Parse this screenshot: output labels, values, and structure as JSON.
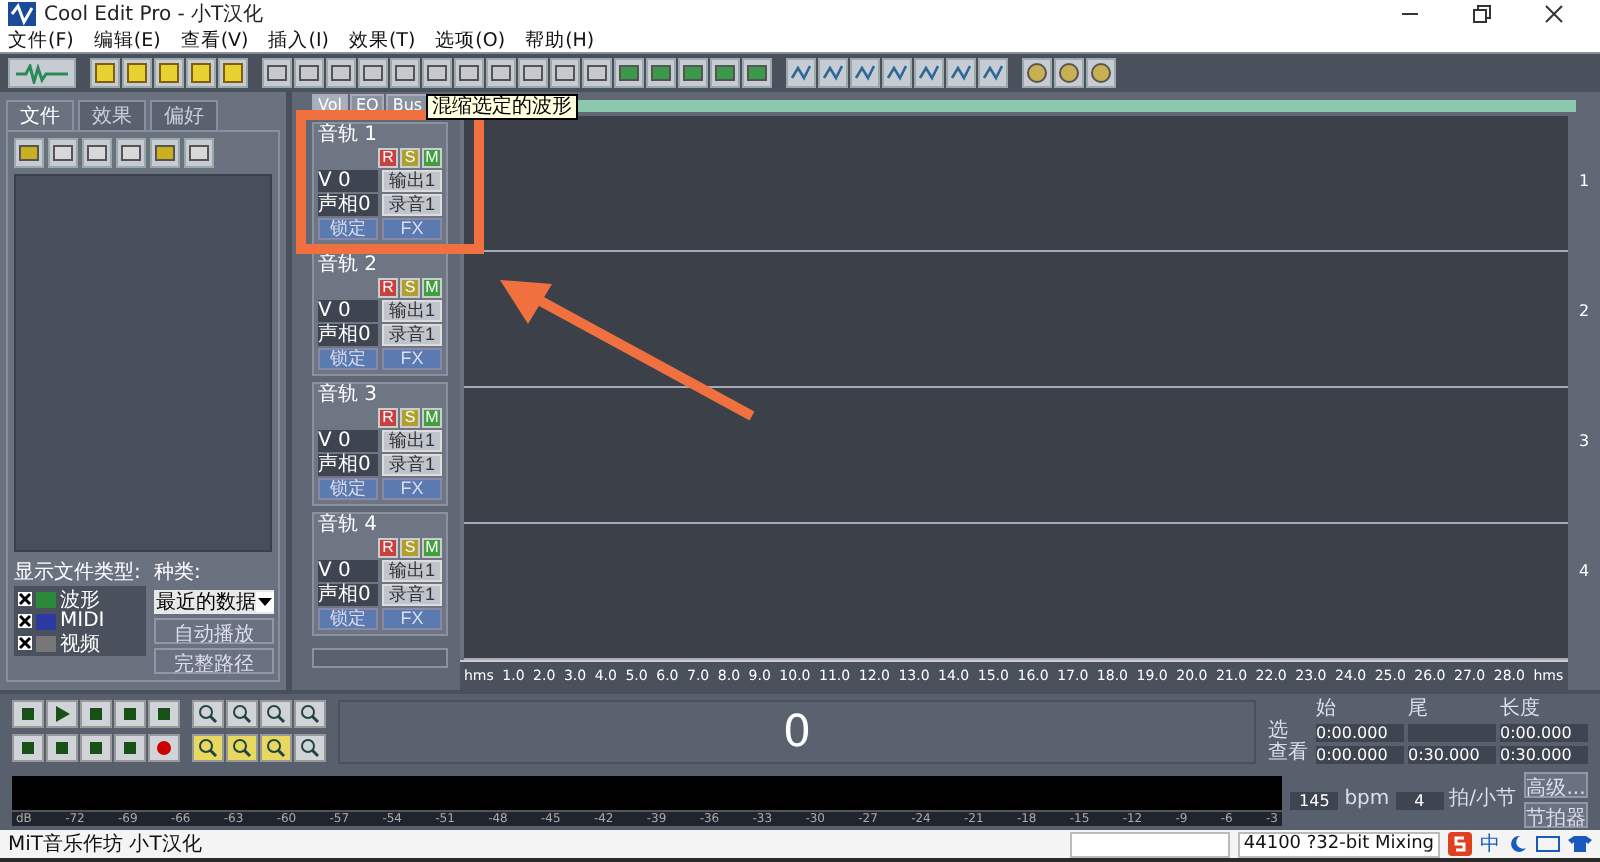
{
  "window": {
    "title": "Cool Edit Pro  - 小T汉化"
  },
  "menu": [
    "文件(F)",
    "编辑(E)",
    "查看(V)",
    "插入(I)",
    "效果(T)",
    "选项(O)",
    "帮助(H)"
  ],
  "left_panel": {
    "tabs": [
      {
        "label": "文件",
        "selected": true
      },
      {
        "label": "效果",
        "selected": false
      },
      {
        "label": "偏好",
        "selected": false
      }
    ],
    "file_types_label": "显示文件类型:",
    "file_types": [
      {
        "label": "波形",
        "checked": true
      },
      {
        "label": "MIDI",
        "checked": true
      },
      {
        "label": "视频",
        "checked": true
      }
    ],
    "sort_label": "种类:",
    "sort_value": "最近的数据",
    "buttons": [
      "自动播放",
      "完整路径"
    ]
  },
  "mixer_tabs": [
    {
      "label": "Vol",
      "selected": true
    },
    {
      "label": "EQ",
      "selected": false
    },
    {
      "label": "Bus",
      "selected": false
    }
  ],
  "tooltip": "混缩选定的波形",
  "tracks": [
    {
      "name": "音轨 1",
      "number": "1",
      "buttons": [
        {
          "kind": "record",
          "label": "R"
        },
        {
          "kind": "solo",
          "label": "S"
        },
        {
          "kind": "mute",
          "label": "M"
        }
      ],
      "volume": "V 0",
      "pan": "声相0",
      "output": "输出1",
      "input": "录音1",
      "lock": "锁定",
      "fx": "FX"
    },
    {
      "name": "音轨 2",
      "number": "2",
      "buttons": [
        {
          "kind": "record",
          "label": "R"
        },
        {
          "kind": "solo",
          "label": "S"
        },
        {
          "kind": "mute",
          "label": "M"
        }
      ],
      "volume": "V 0",
      "pan": "声相0",
      "output": "输出1",
      "input": "录音1",
      "lock": "锁定",
      "fx": "FX"
    },
    {
      "name": "音轨 3",
      "number": "3",
      "buttons": [
        {
          "kind": "record",
          "label": "R"
        },
        {
          "kind": "solo",
          "label": "S"
        },
        {
          "kind": "mute",
          "label": "M"
        }
      ],
      "volume": "V 0",
      "pan": "声相0",
      "output": "输出1",
      "input": "录音1",
      "lock": "锁定",
      "fx": "FX"
    },
    {
      "name": "音轨 4",
      "number": "4",
      "buttons": [
        {
          "kind": "record",
          "label": "R"
        },
        {
          "kind": "solo",
          "label": "S"
        },
        {
          "kind": "mute",
          "label": "M"
        }
      ],
      "volume": "V 0",
      "pan": "声相0",
      "output": "输出1",
      "input": "录音1",
      "lock": "锁定",
      "fx": "FX"
    }
  ],
  "ruler": [
    "hms",
    "1.0",
    "2.0",
    "3.0",
    "4.0",
    "5.0",
    "6.0",
    "7.0",
    "8.0",
    "9.0",
    "10.0",
    "11.0",
    "12.0",
    "13.0",
    "14.0",
    "15.0",
    "16.0",
    "17.0",
    "18.0",
    "19.0",
    "20.0",
    "21.0",
    "22.0",
    "23.0",
    "24.0",
    "25.0",
    "26.0",
    "27.0",
    "28.0",
    "hms"
  ],
  "time_display": "0",
  "time_panel": {
    "headers": [
      "始",
      "尾",
      "长度"
    ],
    "rows": [
      {
        "label": "选",
        "start": "0:00.000",
        "length": "0:00.000"
      },
      {
        "label": "查看",
        "start": "0:00.000",
        "end": "0:30.000",
        "length": "0:30.000"
      }
    ],
    "tempo": "145",
    "tempo_unit": "bpm",
    "beats": "4",
    "beats_unit": "拍/小节",
    "buttons": [
      "高级...",
      "节拍器"
    ]
  },
  "meter_scale": [
    "dB",
    "-72",
    "-69",
    "-66",
    "-63",
    "-60",
    "-57",
    "-54",
    "-51",
    "-48",
    "-45",
    "-42",
    "-39",
    "-36",
    "-33",
    "-30",
    "-27",
    "-24",
    "-21",
    "-18",
    "-15",
    "-12",
    "-9",
    "-6",
    "-3"
  ],
  "status_bar": {
    "text": "MiT音乐作坊 小T汉化",
    "format": "44100 ?32-bit Mixing",
    "ime": "中"
  }
}
